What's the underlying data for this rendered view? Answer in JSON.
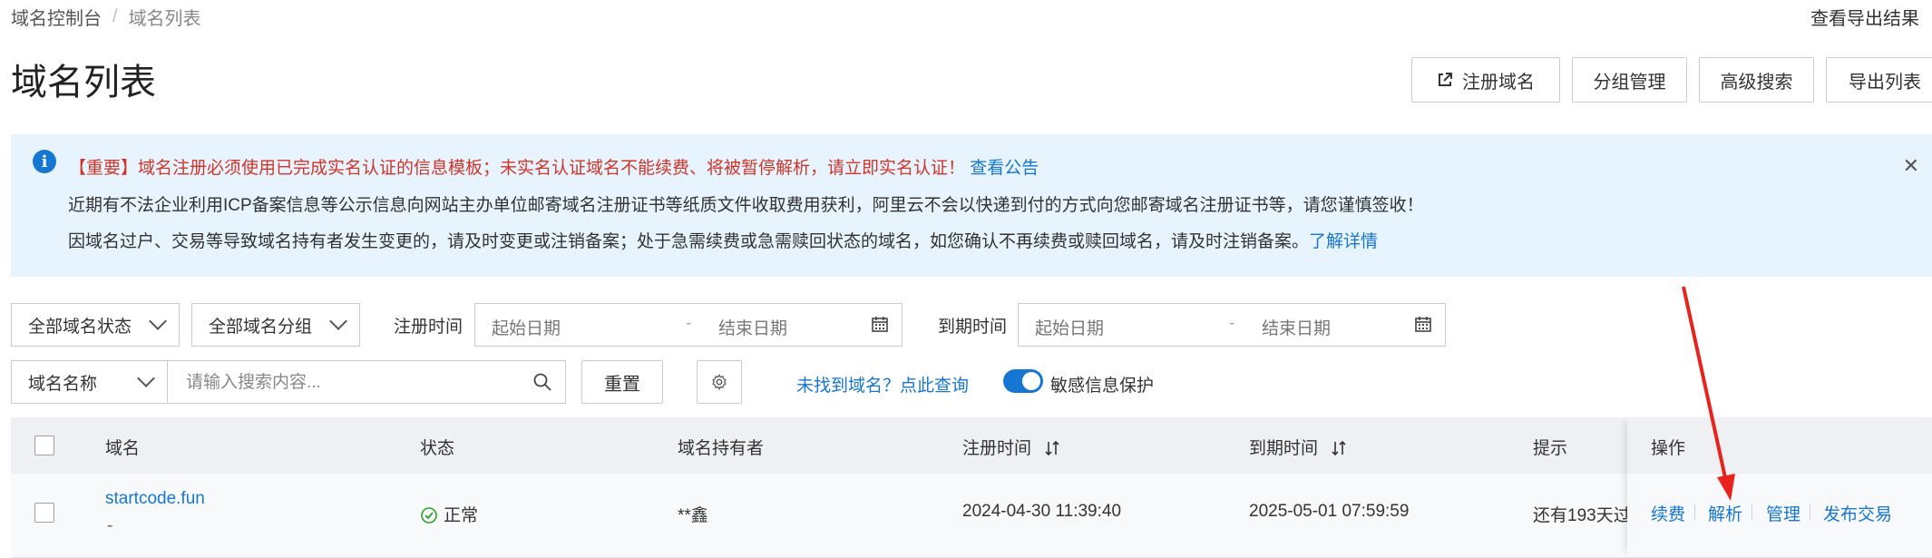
{
  "breadcrumb": {
    "root": "域名控制台",
    "current": "域名列表"
  },
  "header": {
    "export_result": "查看导出结果",
    "title": "域名列表",
    "buttons": {
      "register": "注册域名",
      "group": "分组管理",
      "advanced_search": "高级搜索",
      "export_list": "导出列表"
    }
  },
  "notice": {
    "line1": "【重要】域名注册必须使用已完成实名认证的信息模板；未实名认证域名不能续费、将被暂停解析，请立即实名认证！",
    "line1_link": "查看公告",
    "line2": "近期有不法企业利用ICP备案信息等公示信息向网站主办单位邮寄域名注册证书等纸质文件收取费用获利，阿里云不会以快递到付的方式向您邮寄域名注册证书等，请您谨慎签收！",
    "line3": "因域名过户、交易等导致域名持有者发生变更的，请及时变更或注销备案；处于急需续费或急需赎回状态的域名，如您确认不再续费或赎回域名，请及时注销备案。",
    "line3_link": "了解详情"
  },
  "filters": {
    "status_select": "全部域名状态",
    "group_select": "全部域名分组",
    "reg_time_label": "注册时间",
    "reg_start_placeholder": "起始日期",
    "reg_end_placeholder": "结束日期",
    "exp_time_label": "到期时间",
    "exp_start_placeholder": "起始日期",
    "exp_end_placeholder": "结束日期",
    "field_select": "域名名称",
    "search_placeholder": "请输入搜索内容...",
    "reset": "重置",
    "not_found_link": "未找到域名？点此查询",
    "sensitive_label": "敏感信息保护",
    "sensitive_on": true
  },
  "table": {
    "headers": {
      "domain": "域名",
      "status": "状态",
      "holder": "域名持有者",
      "reg_time": "注册时间",
      "exp_time": "到期时间",
      "tip": "提示",
      "ops": "操作"
    },
    "rows": [
      {
        "domain": "startcode.fun",
        "sub": "-",
        "status": "正常",
        "holder": "**鑫",
        "reg_time": "2024-04-30 11:39:40",
        "exp_time": "2025-05-01 07:59:59",
        "tip": "还有193天过",
        "ops": [
          "续费",
          "解析",
          "管理",
          "发布交易"
        ]
      }
    ]
  },
  "colors": {
    "accent": "#1677d2",
    "warning_text": "#d0352a",
    "notice_bg": "#e7f3fd",
    "annotation_arrow": "#e8231d",
    "status_ok": "#2aa02a"
  }
}
